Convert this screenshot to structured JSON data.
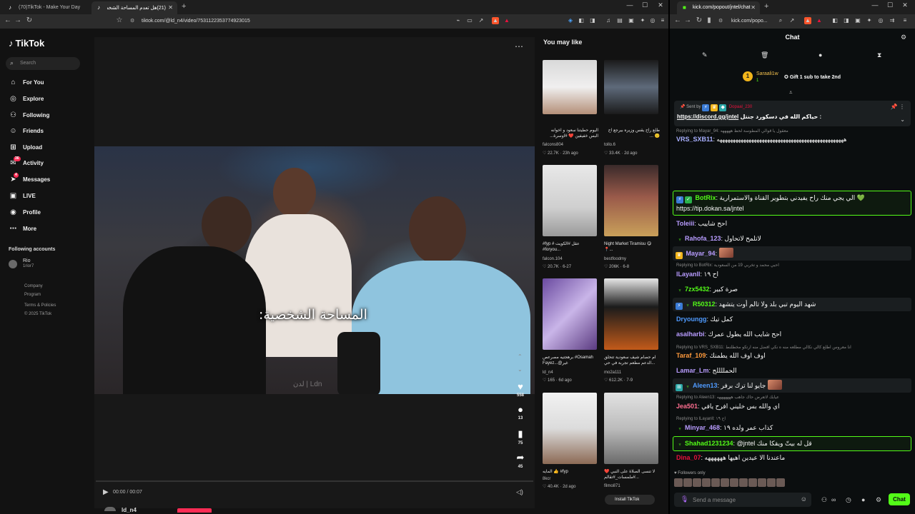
{
  "left_browser": {
    "tabs": [
      {
        "label": "(70)TikTok - Make Your Day"
      },
      {
        "label": "(21)هل تعدم المساحة الشخصية"
      }
    ],
    "url": "tiktok.com/@ld_n4/video/7531122353774923015"
  },
  "tiktok": {
    "logo": "TikTok",
    "search_placeholder": "Search",
    "nav": [
      {
        "label": "For You",
        "icon": "home-icon"
      },
      {
        "label": "Explore",
        "icon": "compass-icon"
      },
      {
        "label": "Following",
        "icon": "following-icon"
      },
      {
        "label": "Friends",
        "icon": "friends-icon"
      },
      {
        "label": "Upload",
        "icon": "upload-icon"
      },
      {
        "label": "Activity",
        "icon": "activity-icon",
        "badge": "36"
      },
      {
        "label": "Messages",
        "icon": "messages-icon",
        "badge": "4"
      },
      {
        "label": "LIVE",
        "icon": "live-icon"
      },
      {
        "label": "Profile",
        "icon": "profile-icon"
      },
      {
        "label": "More",
        "icon": "more-icon"
      }
    ],
    "following_title": "Following accounts",
    "following_accounts": [
      {
        "name": "Rio",
        "handle": "1rior7"
      }
    ],
    "footer": [
      "Company",
      "Program",
      "Terms & Policies",
      "© 2025 TikTok"
    ],
    "video": {
      "caption": "المساحة الشخصية:",
      "watermark": "لدن | Ldn",
      "time": "00:00 / 00:07",
      "author": "ld_n4",
      "likes": "558",
      "comments": "13",
      "saves": "75",
      "shares": "45"
    },
    "you_may_like_title": "You may like",
    "install_label": "Install TikTok",
    "recommendations": [
      {
        "title": "اليوم حطيتنا سعود و اخوانه البس خفيفين ❤️ #اوسرة...",
        "author": "falcons804",
        "likes": "22.7K",
        "age": "23h ago"
      },
      {
        "title": "طلع راح يقس وزيره بيرجع اح 🙂 ...",
        "author": "tollo.6",
        "likes": "33.4K",
        "age": "2d ago"
      },
      {
        "title": "#fyp # عقل #الكويت #foryou...",
        "author": "falcon.104",
        "likes": "20.7K",
        "age": "6-27"
      },
      {
        "title": "Night Market Tiramisu 😋 📍...",
        "author": "bestfoodmy",
        "likes": "206K",
        "age": "6-8"
      },
      {
        "title": "برهجتيه مصرعص #Osamah Fayez...@غير",
        "author": "ld_n4",
        "likes": "165",
        "age": "6d ago"
      },
      {
        "title": "ام حصام شيف سعودية تتحلق ...الدعم مطعم تجربة في حي",
        "author": "mo2a111",
        "likes": "612.2K",
        "age": "7-9"
      },
      {
        "title": "المايه 👍 #fyp",
        "author": "8kcr",
        "likes": "40.4K",
        "age": "2d ago"
      },
      {
        "title": "لا تنسى الصلاة على النبي ❤️ #ملمسات_#تقالم...",
        "author": "filmo871",
        "likes": "",
        "age": ""
      }
    ]
  },
  "right_browser": {
    "tab_label": "kick.com/popout/jntel/chat",
    "url": "kick.com/popo..."
  },
  "chat": {
    "title": "Chat",
    "leaderboard": {
      "rank": "1",
      "name": "Saraali1w",
      "count": "1",
      "gift_label": "Gift 1 sub to take 2nd"
    },
    "pinned": {
      "sent_by": "Sent by",
      "sender": "Dopaal_230",
      "text": "حياكم الله في دسكورد جنتل :",
      "link": "https://discord.gg/jntel"
    },
    "messages": [
      {
        "user": "VRS_SXB11",
        "color": "#a9b0ff",
        "text": "ههههههههههههههههههههههههههههههههههههههههههههههههه",
        "reply": "Replying to Mayar_94: معقول يا قوالي المطوسة لحظ هههههه"
      },
      {
        "user": "BotRix",
        "color": "#53fc18",
        "text": "الي يجي منك راح يفيدني بتطوير القناة والاستمرارية 💚 https://tip.dokan.sa/jntel"
      },
      {
        "user": "Toleiii",
        "color": "#b89cff",
        "text": "احح شاييب"
      },
      {
        "user": "Rahofa_123",
        "color": "#b89cff",
        "text": "لاتلمح لاتحاول"
      },
      {
        "user": "Mayar_94",
        "color": "#b89cff",
        "text": ""
      },
      {
        "user": "lLayanll",
        "color": "#b89cff",
        "text": "اح ١٩",
        "reply": "Replying to BotRix: احبي محمد و تخربي 19 من السعودية"
      },
      {
        "user": "7zx5432",
        "color": "#53fc18",
        "text": "صرة كبير"
      },
      {
        "user": "R50312",
        "color": "#53fc18",
        "text": "شهد اليوم تبي بلد ولا تالم أوت يتشهد"
      },
      {
        "user": "Dryoungg",
        "color": "#4f9bff",
        "text": "كمل تيك"
      },
      {
        "user": "asalharbi",
        "color": "#b89cff",
        "text": "احح شايب الله يطول عمرك"
      },
      {
        "user": "Taraf_109",
        "color": "#ff9a3c",
        "text": "اوف اوف الله يطمنك",
        "reply": "Replying to VRS_SXB11: انا معروس اطلع كالي نكالي مطلعه منه ه نكي افضل منه ارتكو مخطلنط"
      },
      {
        "user": "Lamar_Lm",
        "color": "#b89cff",
        "text": "الحمللللج"
      },
      {
        "user": "Aleen13",
        "color": "#4f9bff",
        "text": "جايو لنا ترك برفر"
      },
      {
        "user": "Jea501",
        "color": "#ff6f91",
        "text": "اي والله بس خليني افرح يافي",
        "reply": "Replying to Aleen13: عيابك لاتعرض حاك جاهب هههههههه"
      },
      {
        "user": "Minyar_468",
        "color": "#b89cff",
        "text": "كذاب عمر ولده ١٩",
        "reply": "Replying to lLayanll: اح ١٩"
      },
      {
        "user": "Shahad1231234",
        "color": "#53fc18",
        "text": "@jntel قل له بيتّ ويقكا منك"
      },
      {
        "user": "Dina_07",
        "color": "#e9113c",
        "text": "ماعندنا الا عيدين اهيها ههههههه"
      }
    ],
    "followers_only": "Followers only",
    "input_placeholder": "Send a message",
    "send_label": "Chat"
  }
}
